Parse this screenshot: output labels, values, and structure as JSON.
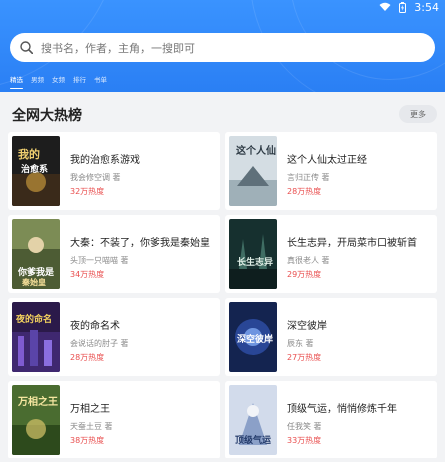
{
  "status_bar": {
    "time": "3:54"
  },
  "search": {
    "placeholder": "搜书名，作者，主角，一搜即可"
  },
  "tabs": [
    "精选",
    "男频",
    "女频",
    "排行",
    "书单"
  ],
  "section": {
    "title": "全网大热榜",
    "more_label": "更多"
  },
  "books": [
    {
      "title": "我的治愈系游戏",
      "author": "我会修空调 著",
      "heat": "32万热度",
      "cover_title": "我的治愈系游戏"
    },
    {
      "title": "这个人仙太过正经",
      "author": "言归正传 著",
      "heat": "28万热度",
      "cover_title": "这个人仙太过正经"
    },
    {
      "title": "大秦：不装了，你爹我是秦始皇",
      "author": "头顶一只喵喵 著",
      "heat": "34万热度",
      "cover_title": "你爹我是秦始皇"
    },
    {
      "title": "长生志异，开局菜市口被斩首",
      "author": "真很老人 著",
      "heat": "29万热度",
      "cover_title": "长生志异"
    },
    {
      "title": "夜的命名术",
      "author": "会说话的肘子 著",
      "heat": "28万热度",
      "cover_title": "夜的命名术"
    },
    {
      "title": "深空彼岸",
      "author": "辰东 著",
      "heat": "27万热度",
      "cover_title": "深空彼岸"
    },
    {
      "title": "万相之王",
      "author": "天蚕土豆 著",
      "heat": "38万热度",
      "cover_title": "万相之王"
    },
    {
      "title": "顶级气运，悄悄修炼千年",
      "author": "任我笑 著",
      "heat": "33万热度",
      "cover_title": "顶级气运"
    }
  ],
  "colors": {
    "header": "#2a7ff4",
    "heat": "#e94e4e",
    "covers": [
      "#2a2a2a",
      "#c9d2d8",
      "#6b7d4a",
      "#1f3b3a",
      "#2b1a4a",
      "#1b2b5a",
      "#3d5f2a",
      "#c6d0e2"
    ]
  }
}
